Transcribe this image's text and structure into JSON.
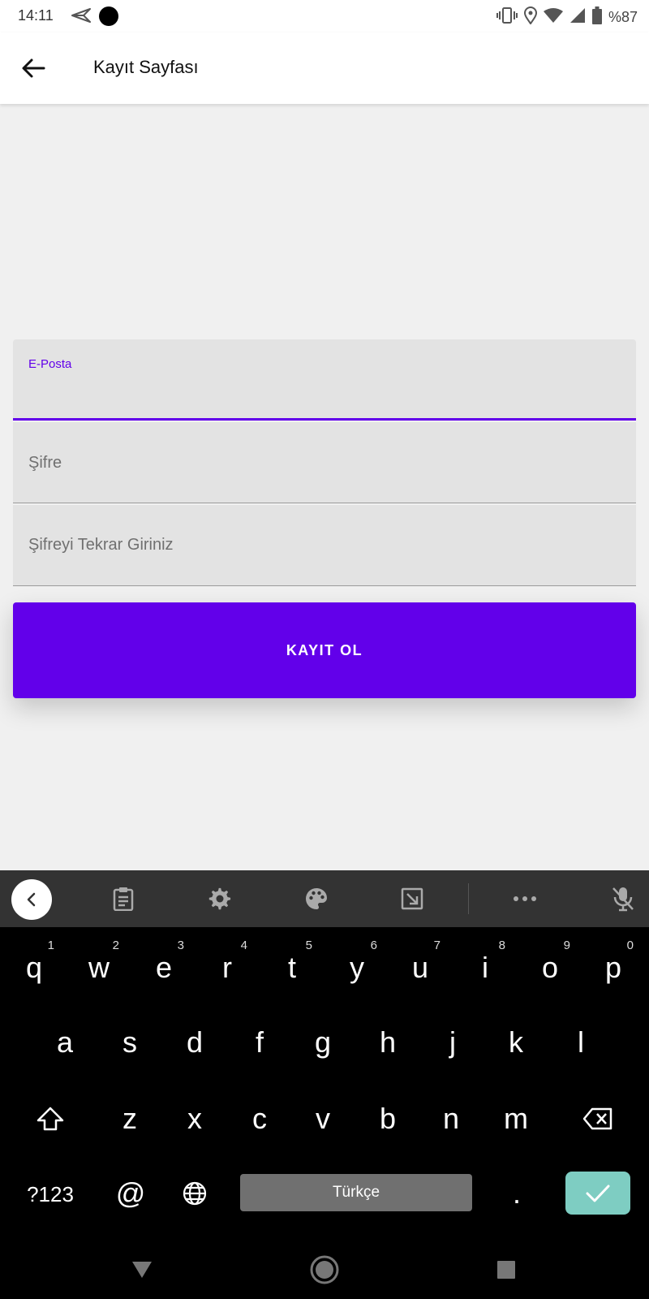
{
  "status_bar": {
    "time": "14:11",
    "battery": "%87"
  },
  "app_bar": {
    "title": "Kayıt Sayfası"
  },
  "form": {
    "email": {
      "label": "E-Posta",
      "value": ""
    },
    "password": {
      "placeholder": "Şifre"
    },
    "password_repeat": {
      "placeholder": "Şifreyi Tekrar Giriniz"
    },
    "submit_label": "KAYIT OL"
  },
  "keyboard": {
    "row1": [
      {
        "k": "q",
        "h": "1"
      },
      {
        "k": "w",
        "h": "2"
      },
      {
        "k": "e",
        "h": "3"
      },
      {
        "k": "r",
        "h": "4"
      },
      {
        "k": "t",
        "h": "5"
      },
      {
        "k": "y",
        "h": "6"
      },
      {
        "k": "u",
        "h": "7"
      },
      {
        "k": "i",
        "h": "8"
      },
      {
        "k": "o",
        "h": "9"
      },
      {
        "k": "p",
        "h": "0"
      }
    ],
    "row2": [
      "a",
      "s",
      "d",
      "f",
      "g",
      "h",
      "j",
      "k",
      "l"
    ],
    "row3": [
      "z",
      "x",
      "c",
      "v",
      "b",
      "n",
      "m"
    ],
    "symbols_label": "?123",
    "at_label": "@",
    "space_label": "Türkçe",
    "period_label": "."
  },
  "colors": {
    "accent": "#6200ea",
    "enter": "#7ecdc2"
  }
}
